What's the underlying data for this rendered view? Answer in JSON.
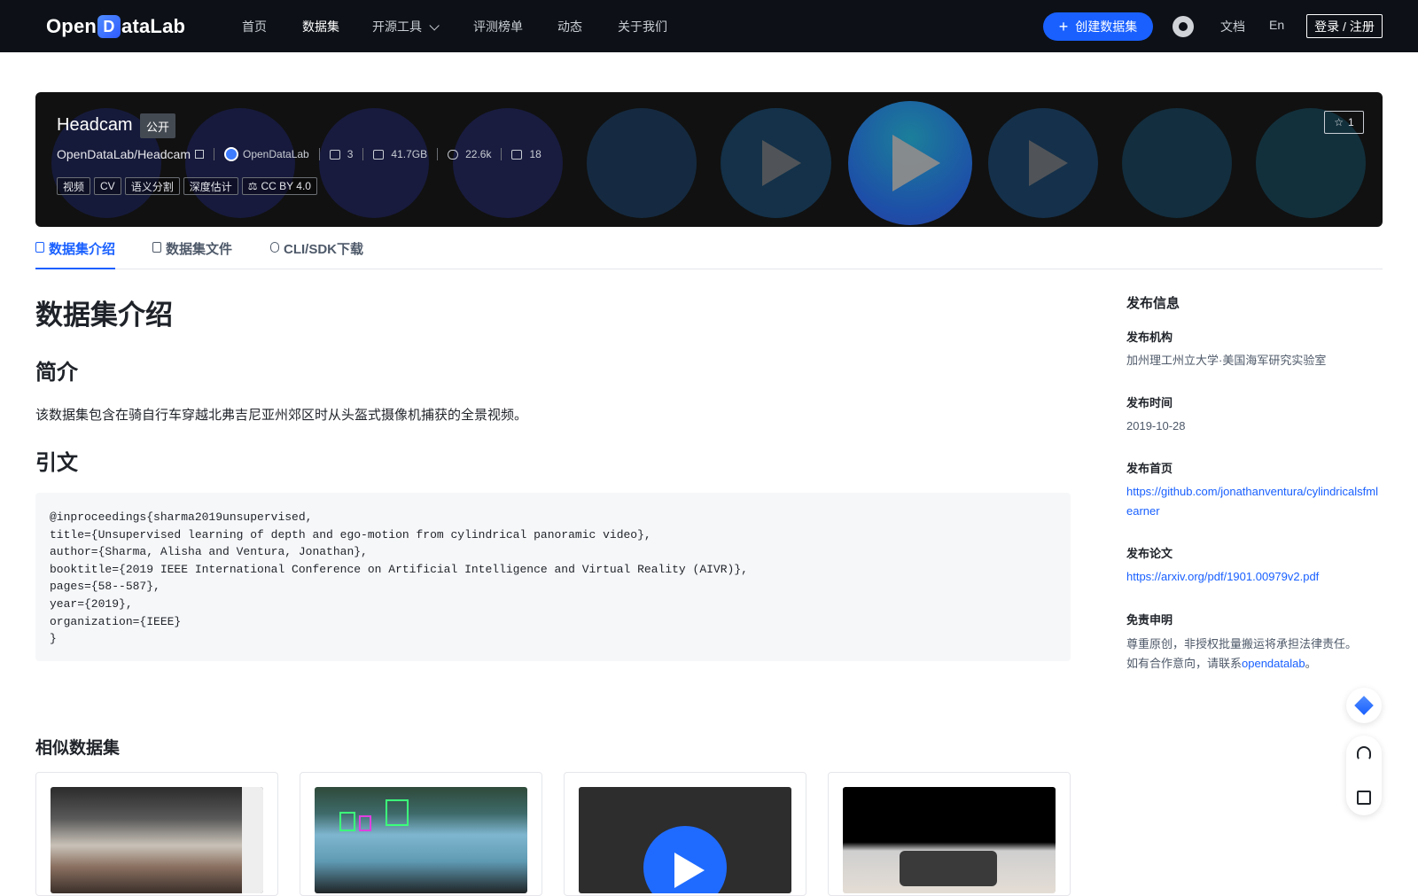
{
  "brand": {
    "logo_left": "Open",
    "logo_mark": "D",
    "logo_right": "ataLab"
  },
  "nav": {
    "items": [
      {
        "label": "首页"
      },
      {
        "label": "数据集"
      },
      {
        "label": "开源工具"
      },
      {
        "label": "评测榜单"
      },
      {
        "label": "动态"
      },
      {
        "label": "关于我们"
      }
    ],
    "active": "数据集",
    "create_label": "创建数据集",
    "docs_label": "文档",
    "lang_label": "En",
    "login_label": "登录 / 注册"
  },
  "dataset": {
    "title": "Headcam",
    "visibility": "公开",
    "path": "OpenDataLab/Headcam",
    "org": "OpenDataLab",
    "stats": {
      "files": "3",
      "size": "41.7GB",
      "views": "22.6k",
      "downloads": "18"
    },
    "tags": [
      "视频",
      "CV",
      "语义分割",
      "深度估计"
    ],
    "license": "CC BY 4.0",
    "stars": "1"
  },
  "tabs": [
    {
      "label": "数据集介绍",
      "icon": "database-icon"
    },
    {
      "label": "数据集文件",
      "icon": "file-icon"
    },
    {
      "label": "CLI/SDK下载",
      "icon": "cloud-download-icon"
    }
  ],
  "content": {
    "heading": "数据集介绍",
    "intro_heading": "简介",
    "intro_text": "该数据集包含在骑自行车穿越北弗吉尼亚州郊区时从头盔式摄像机捕获的全景视频。",
    "citation_heading": "引文",
    "citation": "@inproceedings{sharma2019unsupervised,\ntitle={Unsupervised learning of depth and ego-motion from cylindrical panoramic video},\nauthor={Sharma, Alisha and Ventura, Jonathan},\nbooktitle={2019 IEEE International Conference on Artificial Intelligence and Virtual Reality (AIVR)},\npages={58--587},\nyear={2019},\norganization={IEEE}\n}",
    "similar_heading": "相似数据集"
  },
  "sidebar": {
    "title": "发布信息",
    "org_label": "发布机构",
    "org_value": "加州理工州立大学·美国海军研究实验室",
    "time_label": "发布时间",
    "time_value": "2019-10-28",
    "home_label": "发布首页",
    "home_value": "https://github.com/jonathanventura/cylindricalsfmlearner",
    "paper_label": "发布论文",
    "paper_value": "https://arxiv.org/pdf/1901.00979v2.pdf",
    "disclaimer_label": "免责申明",
    "disclaimer_line1": "尊重原创，非授权批量搬运将承担法律责任。",
    "disclaimer_line2_prefix": "如有合作意向，请联系",
    "disclaimer_link": "opendatalab",
    "disclaimer_line2_suffix": "。"
  },
  "colors": {
    "accent": "#1960ff",
    "nav_bg": "#0d1117",
    "hero_bg": "#111111"
  }
}
